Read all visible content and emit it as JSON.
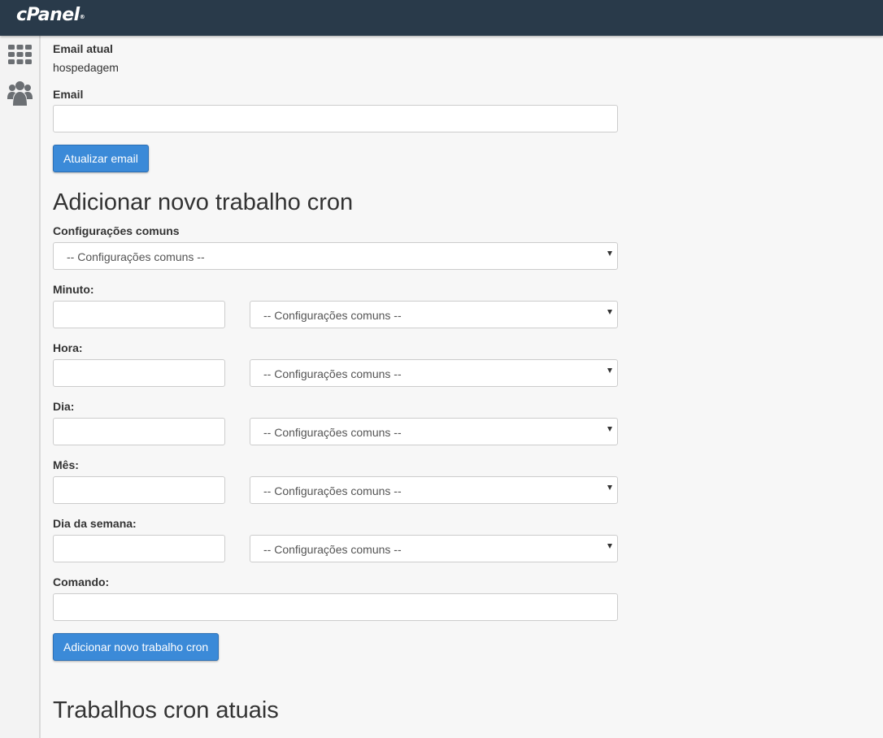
{
  "app": {
    "logo_text": "cPanel",
    "logo_mark": "®"
  },
  "sidebar": {
    "items": [
      {
        "icon": "grid-icon"
      },
      {
        "icon": "users-icon"
      }
    ]
  },
  "email_section": {
    "current_label": "Email atual",
    "current_value": "hospedagem",
    "email_label": "Email",
    "email_value": "",
    "update_button": "Atualizar email"
  },
  "add_cron": {
    "heading": "Adicionar novo trabalho cron",
    "common_settings_label": "Configurações comuns",
    "common_settings_selected": "-- Configurações comuns --",
    "fields": [
      {
        "label": "Minuto:",
        "value": "",
        "select": "-- Configurações comuns --"
      },
      {
        "label": "Hora:",
        "value": "",
        "select": "-- Configurações comuns --"
      },
      {
        "label": "Dia:",
        "value": "",
        "select": "-- Configurações comuns --"
      },
      {
        "label": "Mês:",
        "value": "",
        "select": "-- Configurações comuns --"
      },
      {
        "label": "Dia da semana:",
        "value": "",
        "select": "-- Configurações comuns --"
      }
    ],
    "command_label": "Comando:",
    "command_value": "",
    "add_button": "Adicionar novo trabalho cron"
  },
  "current_cron": {
    "heading": "Trabalhos cron atuais"
  },
  "colors": {
    "topbar": "#293a4a",
    "primary_button": "#3b8ad8",
    "background": "#f7f7f7"
  }
}
